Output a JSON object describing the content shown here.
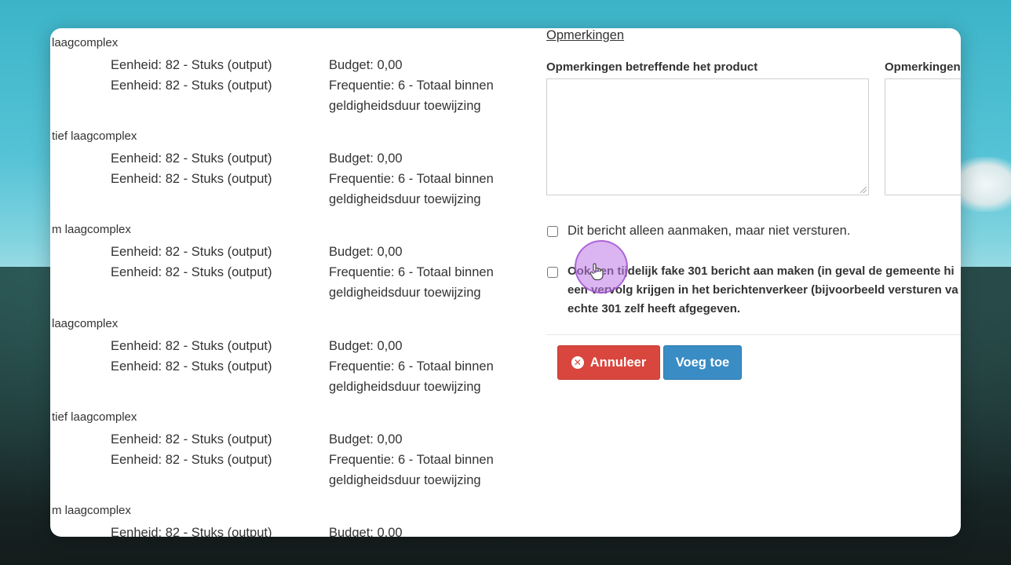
{
  "groups": [
    {
      "title": "laagcomplex",
      "unit1": "Eenheid: 82 - Stuks (output)",
      "budget": "Budget: 0,00",
      "unit2": "Eenheid: 82 - Stuks (output)",
      "freq1": "Frequentie: 6 - Totaal binnen",
      "freq2": "geldigheidsduur toewijzing"
    },
    {
      "title": "tief laagcomplex",
      "unit1": "Eenheid: 82 - Stuks (output)",
      "budget": "Budget: 0,00",
      "unit2": "Eenheid: 82 - Stuks (output)",
      "freq1": "Frequentie: 6 - Totaal binnen",
      "freq2": "geldigheidsduur toewijzing"
    },
    {
      "title": "m laagcomplex",
      "unit1": "Eenheid: 82 - Stuks (output)",
      "budget": "Budget: 0,00",
      "unit2": "Eenheid: 82 - Stuks (output)",
      "freq1": "Frequentie: 6 - Totaal binnen",
      "freq2": "geldigheidsduur toewijzing"
    },
    {
      "title": "laagcomplex",
      "unit1": "Eenheid: 82 - Stuks (output)",
      "budget": "Budget: 0,00",
      "unit2": "Eenheid: 82 - Stuks (output)",
      "freq1": "Frequentie: 6 - Totaal binnen",
      "freq2": "geldigheidsduur toewijzing"
    },
    {
      "title": "tief laagcomplex",
      "unit1": "Eenheid: 82 - Stuks (output)",
      "budget": "Budget: 0,00",
      "unit2": "Eenheid: 82 - Stuks (output)",
      "freq1": "Frequentie: 6 - Totaal binnen",
      "freq2": "geldigheidsduur toewijzing"
    },
    {
      "title": "m laagcomplex",
      "unit1": "Eenheid: 82 - Stuks (output)",
      "budget": "Budget: 0.00"
    }
  ],
  "remarks": {
    "section_title": "Opmerkingen",
    "product_label": "Opmerkingen betreffende het product",
    "second_label": "Opmerkingen",
    "product_value": "",
    "second_value": ""
  },
  "options": {
    "create_only": "Dit bericht alleen aanmaken, maar niet versturen.",
    "fake301_line1": "Ook een tijdelijk fake 301 bericht aan maken (in geval de gemeente hi",
    "fake301_line2": "een vervolg krijgen in het berichtenverkeer (bijvoorbeeld versturen va",
    "fake301_line3": "echte 301 zelf heeft afgegeven."
  },
  "buttons": {
    "cancel": "Annuleer",
    "cancel_icon": "x-circle-icon",
    "add": "Voeg toe"
  },
  "colors": {
    "cancel": "#d9463e",
    "add": "#3a8cc4",
    "cursor_highlight": "#be78e6"
  }
}
